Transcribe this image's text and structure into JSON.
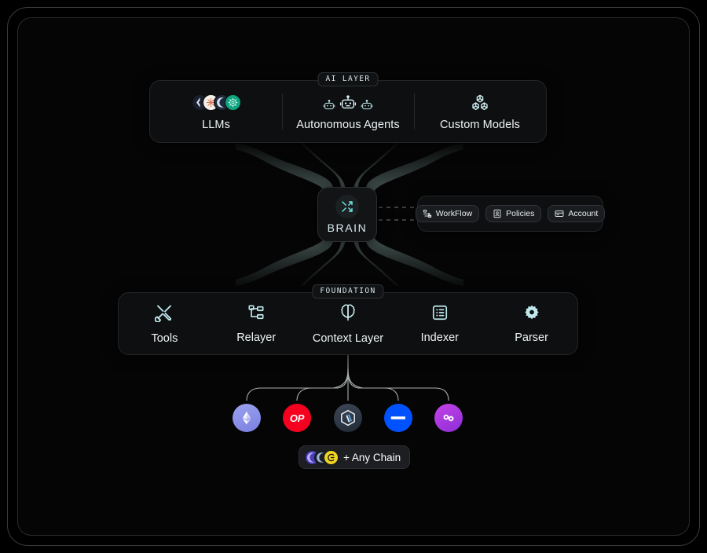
{
  "frame": {
    "name": "architecture-diagram-frame"
  },
  "ai_layer": {
    "badge": "AI LAYER",
    "cells": [
      {
        "label": "LLMs",
        "icon": "llm-logos-icon"
      },
      {
        "label": "Autonomous Agents",
        "icon": "robot-icon"
      },
      {
        "label": "Custom Models",
        "icon": "cubes-icon"
      }
    ]
  },
  "brain": {
    "label": "BRAIN",
    "icon": "shuffle-icon"
  },
  "chips": [
    {
      "label": "WorkFlow",
      "icon": "workflow-icon"
    },
    {
      "label": "Policies",
      "icon": "policy-icon"
    },
    {
      "label": "Account",
      "icon": "account-icon"
    }
  ],
  "foundation": {
    "badge": "FOUNDATION",
    "cells": [
      {
        "label": "Tools",
        "icon": "tools-icon"
      },
      {
        "label": "Relayer",
        "icon": "hierarchy-icon"
      },
      {
        "label": "Context Layer",
        "icon": "brain-icon"
      },
      {
        "label": "Indexer",
        "icon": "list-icon"
      },
      {
        "label": "Parser",
        "icon": "gear-icon"
      }
    ]
  },
  "chains": [
    {
      "name": "ethereum",
      "color": "#8a92e8"
    },
    {
      "name": "optimism",
      "color": "#ff0420"
    },
    {
      "name": "arbitrum",
      "color": "#2d374b"
    },
    {
      "name": "base",
      "color": "#0052ff"
    },
    {
      "name": "polygon",
      "color": "#a233d6"
    }
  ],
  "any_chain": {
    "label": "+ Any Chain"
  },
  "colors": {
    "accent": "#9fe3e8",
    "panel_bg": "#0e0f10",
    "panel_border": "#232528",
    "page_bg": "#000000",
    "connector": "#5c6d6b",
    "branch_line": "#cfd4d6"
  }
}
